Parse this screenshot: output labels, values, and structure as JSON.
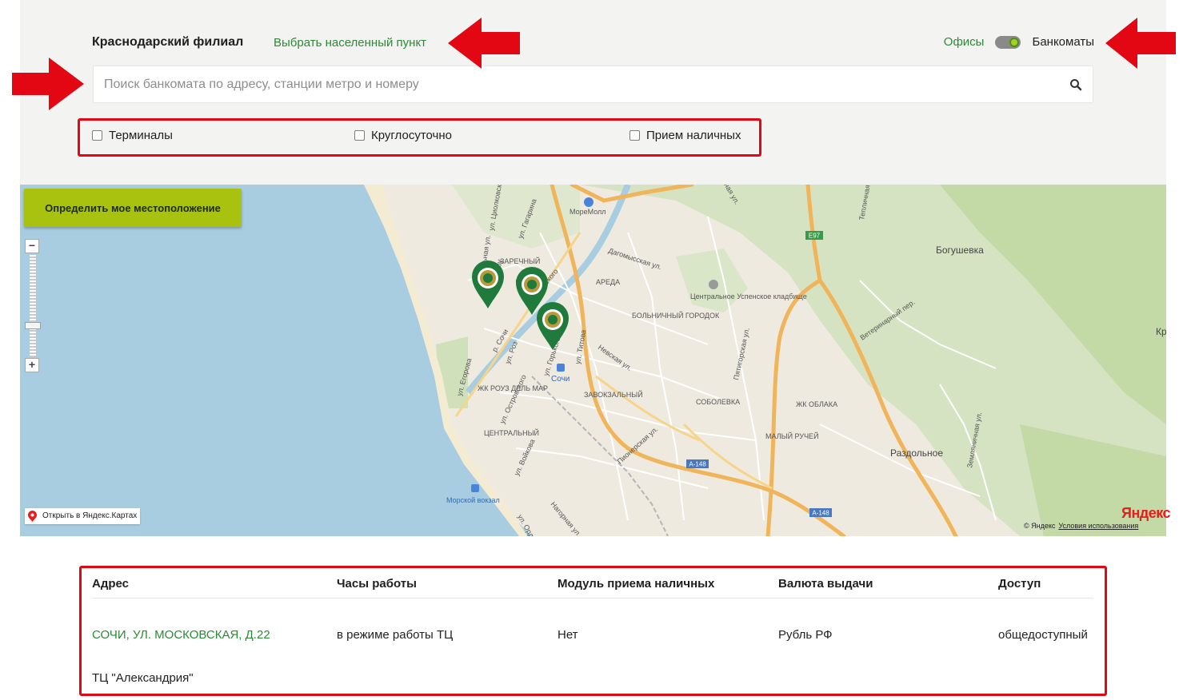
{
  "header": {
    "branch_title": "Краснодарский филиал",
    "choose_city_link": "Выбрать населенный пункт",
    "toggle": {
      "left_label": "Офисы",
      "right_label": "Банкоматы",
      "state": "Банкоматы"
    }
  },
  "search": {
    "placeholder": "Поиск банкомата по адресу, станции метро и номеру",
    "value": ""
  },
  "filters": [
    {
      "label": "Терминалы",
      "checked": false
    },
    {
      "label": "Круглосуточно",
      "checked": false
    },
    {
      "label": "Прием наличных",
      "checked": false
    }
  ],
  "map": {
    "locate_button": "Определить мое местоположение",
    "open_in_yandex": "Открыть в Яндекс.Картах",
    "logo": "Яндекс",
    "copyright": "© Яндекс",
    "terms_link": "Условия использования",
    "zoom_in": "+",
    "zoom_out": "−",
    "labels": {
      "moremall": "МореМолл",
      "zarechny": "ЗАРЕЧНЫЙ",
      "areda": "АРЕДА",
      "hospital_town": "БОЛЬНИЧНЫЙ ГОРОДОК",
      "cemetery": "Центральное Успенское кладбище",
      "bogushevka": "Богушевка",
      "zhk_rouz": "ЖК РОУЗ ДЕЛЬ МАР",
      "central": "ЦЕНТРАЛЬНЫЙ",
      "vokzalny": "ЗАВОКЗАЛЬНЫЙ",
      "sobolevka": "СОБОЛЕВКА",
      "zhk_oblaka": "ЖК ОБЛАКА",
      "maly_ruchei": "МАЛЫЙ РУЧЕЙ",
      "razdolnoe": "Раздольное",
      "sochi": "Сочи",
      "sea_station": "Морской вокзал",
      "e97": "E97",
      "a148": "А-148",
      "kr": "Кр",
      "st_egorova": "ул. Егорова",
      "st_gagarina": "ул. Гагарина",
      "st_gorkogo": "ул. Горького",
      "st_titova": "ул. Титова",
      "st_dagomysskaya": "Дагомысская ул.",
      "st_pionerskaya": "Пионерская ул.",
      "st_pyatigorskaya": "Пятигорская ул.",
      "st_nevskaya": "Невская ул.",
      "st_veterinarny": "Ветеринарный пер.",
      "st_zemlyanichnaya": "Земляничная ул.",
      "st_teplichnaya": "Тепличная ул.",
      "st_voikova": "ул. Войкова",
      "st_ostrovskogo": "ул. Островского",
      "st_nagornaya": "Нагорная ул.",
      "st_rosa": "ул. Роз",
      "st_tsiolkovskogo": "ул. Циолковского",
      "st_gospitalnaya": "Госпитальная ул.",
      "st_ord": "ул. Орд",
      "st_chaikovskogo": "Чайковского",
      "st_top": "ная ул.",
      "st_sochi": "р. Сочи",
      "st_bul": "бул.",
      "st_cerou": "Цероу"
    },
    "colors": {
      "water": "#a8cde0",
      "land": "#efeae0",
      "forest": "#c9ddb0",
      "road_major": "#f0b45a",
      "marker": "#1f7a3c"
    },
    "markers_count": 3
  },
  "table": {
    "headers": [
      "Адрес",
      "Часы работы",
      "Модуль приема наличных",
      "Валюта выдачи",
      "Доступ"
    ],
    "rows": [
      {
        "address": "СОЧИ, УЛ. МОСКОВСКАЯ, Д.22",
        "hours": "в режиме работы ТЦ",
        "cash_module": "Нет",
        "currency": "Рубль РФ",
        "access": "общедоступный",
        "note": "ТЦ \"Александрия\""
      }
    ]
  },
  "annotation_color": "#e30613"
}
